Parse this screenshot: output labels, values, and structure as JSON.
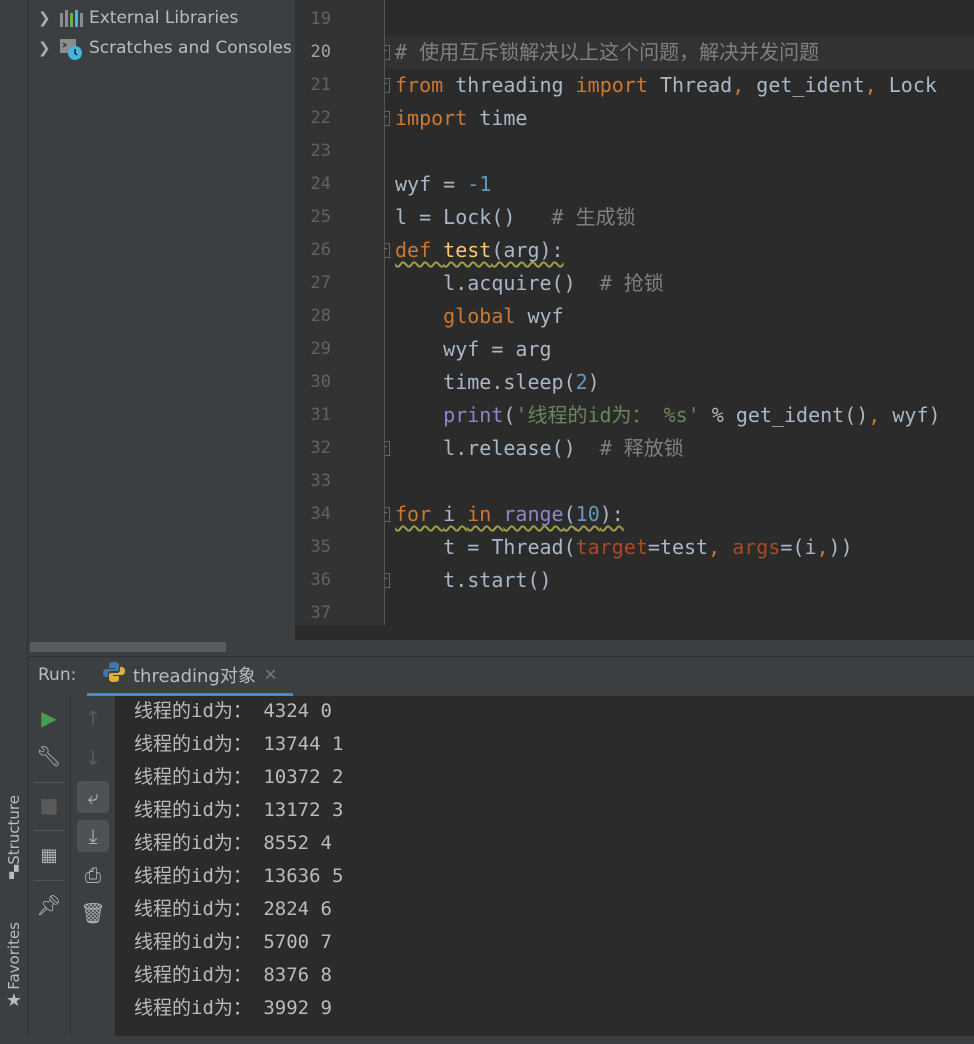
{
  "project_tree": {
    "items": [
      {
        "label": "External Libraries",
        "icon": "library-icon"
      },
      {
        "label": "Scratches and Consoles",
        "icon": "scratches-icon"
      }
    ]
  },
  "editor": {
    "current_line": 20,
    "lines": [
      {
        "n": 19,
        "tokens": []
      },
      {
        "n": 20,
        "fold": true,
        "tokens": [
          [
            "cm",
            "# 使用互斥锁解决以上这个问题，解决并发问题"
          ]
        ]
      },
      {
        "n": 21,
        "fold": true,
        "tokens": [
          [
            "kw",
            "from "
          ],
          [
            "id",
            "threading "
          ],
          [
            "kw",
            "import "
          ],
          [
            "id",
            "Thread"
          ],
          [
            "kw",
            ", "
          ],
          [
            "id",
            "get_ident"
          ],
          [
            "kw",
            ", "
          ],
          [
            "id",
            "Lock"
          ]
        ]
      },
      {
        "n": 22,
        "fold": true,
        "tokens": [
          [
            "kw",
            "import "
          ],
          [
            "id",
            "time"
          ]
        ]
      },
      {
        "n": 23,
        "tokens": []
      },
      {
        "n": 24,
        "tokens": [
          [
            "id",
            "wyf = "
          ],
          [
            "num",
            "-1"
          ]
        ]
      },
      {
        "n": 25,
        "tokens": [
          [
            "id",
            "l = Lock()   "
          ],
          [
            "cm",
            "# 生成锁"
          ]
        ]
      },
      {
        "n": 26,
        "fold": true,
        "wavy": true,
        "tokens": [
          [
            "kw",
            "def "
          ],
          [
            "fn",
            "test"
          ],
          [
            "id",
            "(arg):"
          ]
        ]
      },
      {
        "n": 27,
        "tokens": [
          [
            "id",
            "    l.acquire()  "
          ],
          [
            "cm",
            "# 抢锁"
          ]
        ]
      },
      {
        "n": 28,
        "tokens": [
          [
            "kw",
            "    global "
          ],
          [
            "id",
            "wyf"
          ]
        ]
      },
      {
        "n": 29,
        "tokens": [
          [
            "id",
            "    wyf = arg"
          ]
        ]
      },
      {
        "n": 30,
        "tokens": [
          [
            "id",
            "    time.sleep("
          ],
          [
            "num",
            "2"
          ],
          [
            "id",
            ")"
          ]
        ]
      },
      {
        "n": 31,
        "tokens": [
          [
            "bi",
            "    print"
          ],
          [
            "id",
            "("
          ],
          [
            "str",
            "'线程的id为： %s'"
          ],
          [
            "id",
            " % get_ident()"
          ],
          [
            "kw",
            ", "
          ],
          [
            "id",
            "wyf)"
          ]
        ]
      },
      {
        "n": 32,
        "fold": true,
        "tokens": [
          [
            "id",
            "    l.release()  "
          ],
          [
            "cm",
            "# 释放锁"
          ]
        ]
      },
      {
        "n": 33,
        "tokens": []
      },
      {
        "n": 34,
        "fold": true,
        "wavy": true,
        "tokens": [
          [
            "kw",
            "for "
          ],
          [
            "id",
            "i "
          ],
          [
            "kw",
            "in "
          ],
          [
            "bi",
            "range"
          ],
          [
            "id",
            "("
          ],
          [
            "num",
            "10"
          ],
          [
            "id",
            "):"
          ]
        ]
      },
      {
        "n": 35,
        "tokens": [
          [
            "id",
            "    t = Thread("
          ],
          [
            "par",
            "target"
          ],
          [
            "id",
            "=test"
          ],
          [
            "kw",
            ", "
          ],
          [
            "par",
            "args"
          ],
          [
            "id",
            "=(i"
          ],
          [
            "kw",
            ","
          ],
          [
            "id",
            "))"
          ]
        ]
      },
      {
        "n": 36,
        "fold": true,
        "tokens": [
          [
            "id",
            "    t.start()"
          ]
        ]
      },
      {
        "n": 37,
        "tokens": []
      }
    ]
  },
  "run": {
    "label": "Run:",
    "tab": "threading对象",
    "output": [
      "线程的id为： 4324 0",
      "线程的id为： 13744 1",
      "线程的id为： 10372 2",
      "线程的id为： 13172 3",
      "线程的id为： 8552 4",
      "线程的id为： 13636 5",
      "线程的id为： 2824 6",
      "线程的id为： 5700 7",
      "线程的id为： 8376 8",
      "线程的id为： 3992 9"
    ]
  },
  "side_tabs": {
    "structure": "Structure",
    "favorites": "Favorites"
  },
  "colors": {
    "run_green": "#499c54",
    "accent": "#4a88c7"
  }
}
